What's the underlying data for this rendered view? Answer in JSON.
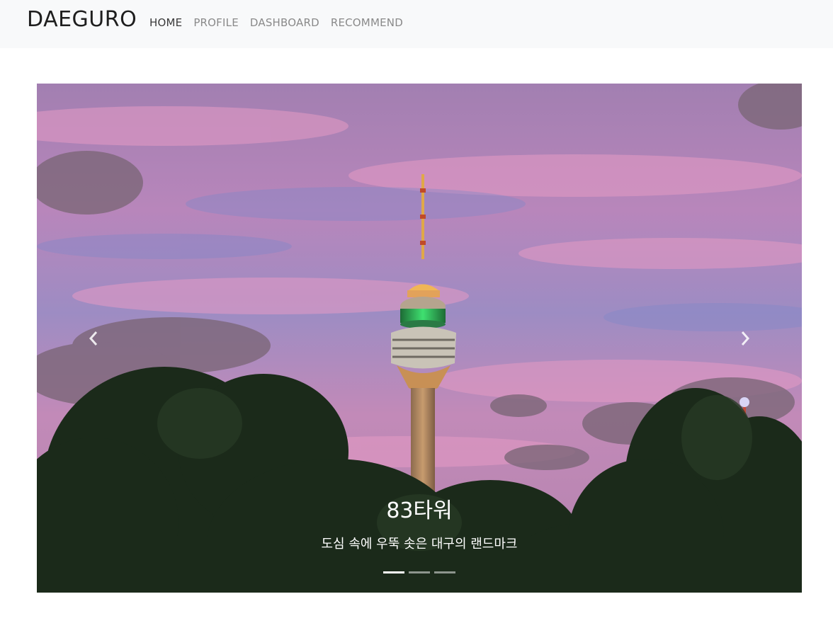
{
  "navbar": {
    "brand": "DAEGURO",
    "links": [
      {
        "label": "HOME",
        "active": true
      },
      {
        "label": "PROFILE",
        "active": false
      },
      {
        "label": "DASHBOARD",
        "active": false
      },
      {
        "label": "RECOMMEND",
        "active": false
      }
    ]
  },
  "carousel": {
    "caption_title": "83타워",
    "caption_text": "도심 속에 우뚝 솟은 대구의 랜드마크",
    "slide_count": 3,
    "active_slide": 1,
    "prev_icon": "chevron-left-icon",
    "next_icon": "chevron-right-icon"
  },
  "colors": {
    "navbar_bg": "#f8f9fa",
    "brand_text": "#1e1e1e",
    "nav_active": "#3a3a3a",
    "nav_inactive": "#8a8a8a",
    "sky_top": "#9c7bb0",
    "sky_pink": "#d58fb6"
  }
}
